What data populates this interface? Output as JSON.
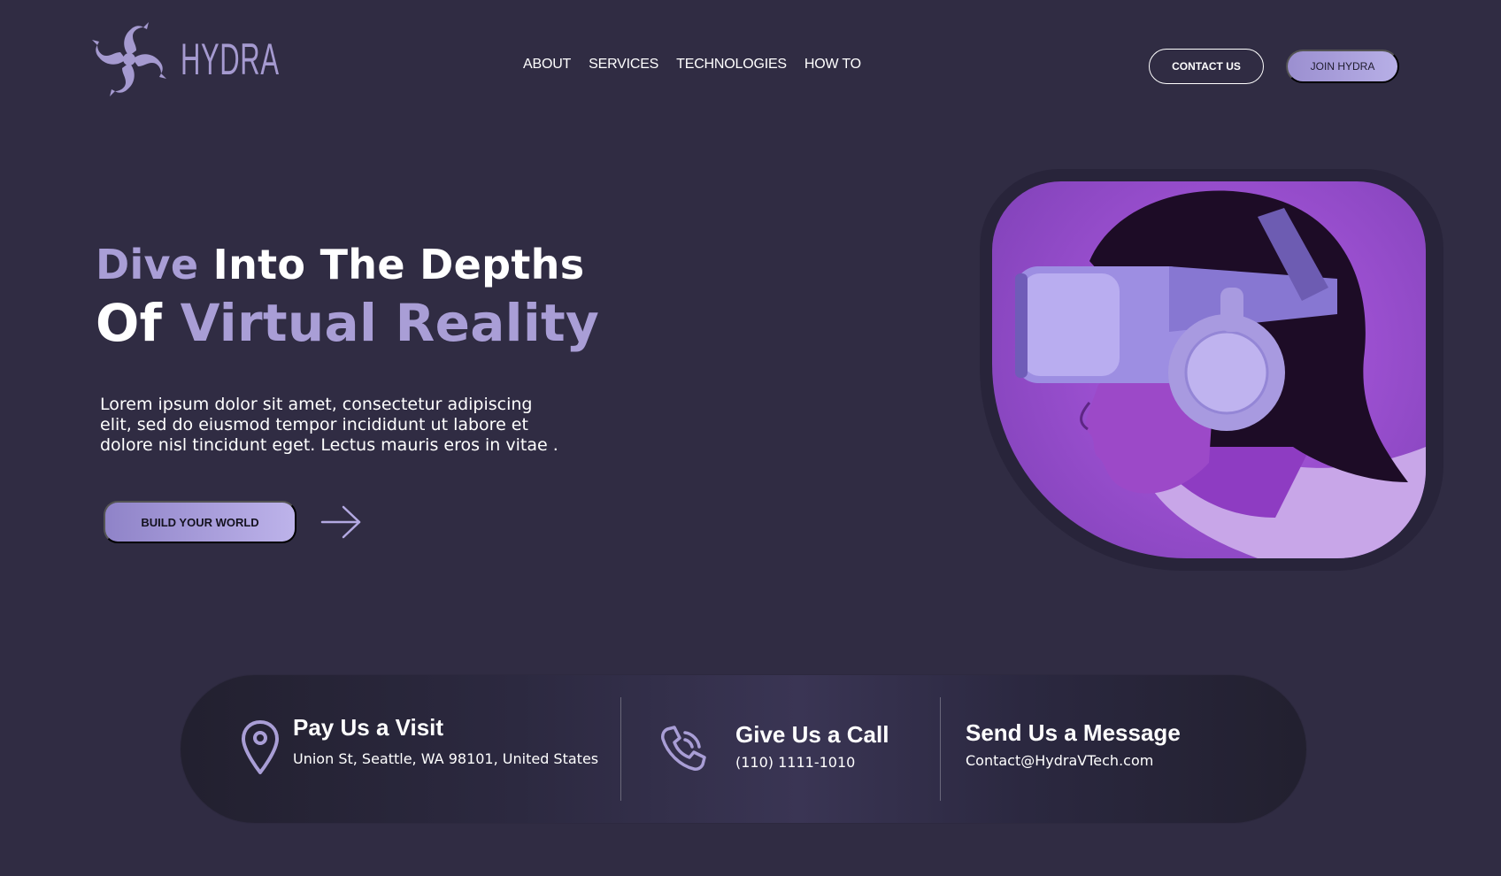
{
  "brand": {
    "name": "HYDRA",
    "logo_icon": "hydra-swirl-icon",
    "accent_color": "#a99ed6",
    "background_color": "#302c43"
  },
  "nav": {
    "items": [
      {
        "label": "ABOUT"
      },
      {
        "label": "SERVICES"
      },
      {
        "label": "TECHNOLOGIES"
      },
      {
        "label": "HOW TO"
      }
    ]
  },
  "header_actions": {
    "contact_label": "CONTACT US",
    "join_label": "JOIN HYDRA"
  },
  "hero": {
    "title_line1_accent": "Dive",
    "title_line1_rest": " Into The Depths",
    "title_line2_plain": "Of ",
    "title_line2_accent": "Virtual Reality",
    "body": "Lorem ipsum dolor sit amet, consectetur adipiscing elit, sed do eiusmod tempor incididunt ut labore et dolore nisl tincidunt eget. Lectus mauris eros in vitae .",
    "cta_label": "BUILD YOUR WORLD",
    "arrow_icon": "arrow-right-icon",
    "image_icon": "vr-headset-person-image"
  },
  "contact": {
    "visit": {
      "icon": "location-pin-icon",
      "title": "Pay Us a Visit",
      "detail": "Union St, Seattle, WA 98101, United States"
    },
    "call": {
      "icon": "phone-icon",
      "title": "Give Us a Call",
      "detail": "(110) 1111-1010"
    },
    "message": {
      "title": "Send Us a Message",
      "detail": "Contact@HydraVTech.com"
    }
  }
}
